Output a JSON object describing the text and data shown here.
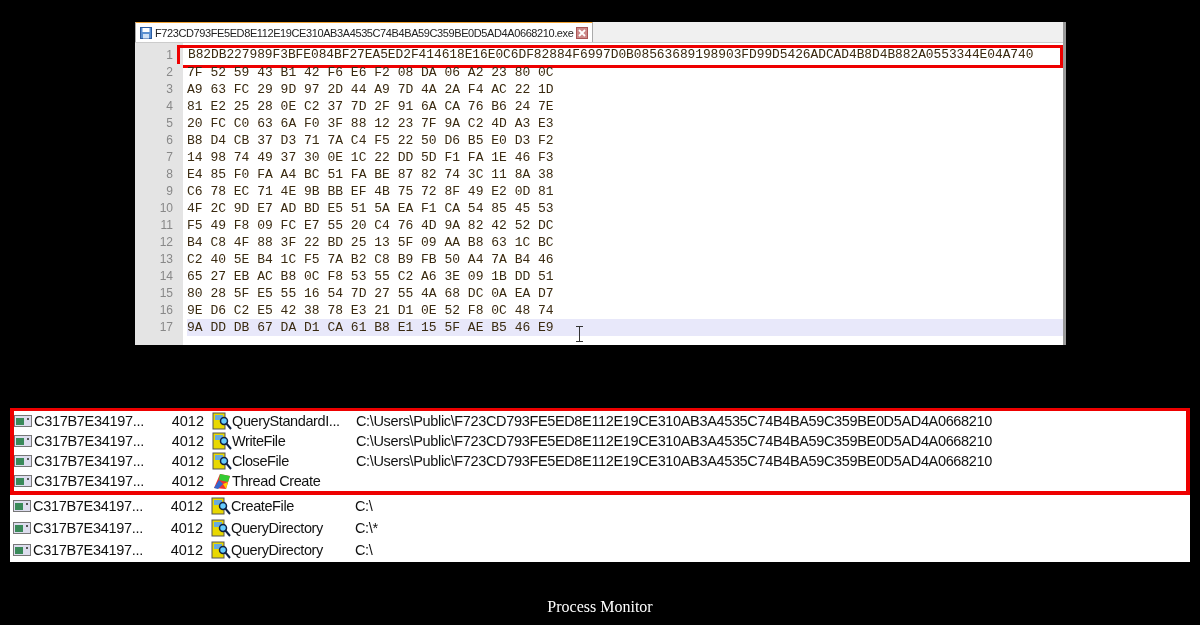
{
  "editor": {
    "tab": {
      "title": "F723CD793FE5ED8E112E19CE310AB3A4535C74B4BA59C359BE0D5AD4A0668210.exe",
      "selected": true
    },
    "lines": [
      {
        "number": "1",
        "text": "B82DB227989F3BFE084BF27EA5ED2F414618E16E0C6DF82884F6997D0B08563689198903FD99D5426ADCAD4B8D4B882A0553344E04A740",
        "current": false,
        "highlighted": true
      },
      {
        "number": "2",
        "text": "7F 52 59 43 B1 42 F6 E6 F2 08 DA 06 A2 23 80 0C",
        "current": false,
        "highlighted": false
      },
      {
        "number": "3",
        "text": "A9 63 FC 29 9D 97 2D 44 A9 7D 4A 2A F4 AC 22 1D",
        "current": false,
        "highlighted": false
      },
      {
        "number": "4",
        "text": "81 E2 25 28 0E C2 37 7D 2F 91 6A CA 76 B6 24 7E",
        "current": false,
        "highlighted": false
      },
      {
        "number": "5",
        "text": "20 FC C0 63 6A F0 3F 88 12 23 7F 9A C2 4D A3 E3",
        "current": false,
        "highlighted": false
      },
      {
        "number": "6",
        "text": "B8 D4 CB 37 D3 71 7A C4 F5 22 50 D6 B5 E0 D3 F2",
        "current": false,
        "highlighted": false
      },
      {
        "number": "7",
        "text": "14 98 74 49 37 30 0E 1C 22 DD 5D F1 FA 1E 46 F3",
        "current": false,
        "highlighted": false
      },
      {
        "number": "8",
        "text": "E4 85 F0 FA A4 BC 51 FA BE 87 82 74 3C 11 8A 38",
        "current": false,
        "highlighted": false
      },
      {
        "number": "9",
        "text": "C6 78 EC 71 4E 9B BB EF 4B 75 72 8F 49 E2 0D 81",
        "current": false,
        "highlighted": false
      },
      {
        "number": "10",
        "text": "4F 2C 9D E7 AD BD E5 51 5A EA F1 CA 54 85 45 53",
        "current": false,
        "highlighted": false
      },
      {
        "number": "11",
        "text": "F5 49 F8 09 FC E7 55 20 C4 76 4D 9A 82 42 52 DC",
        "current": false,
        "highlighted": false
      },
      {
        "number": "12",
        "text": "B4 C8 4F 88 3F 22 BD 25 13 5F 09 AA B8 63 1C BC",
        "current": false,
        "highlighted": false
      },
      {
        "number": "13",
        "text": "C2 40 5E B4 1C F5 7A B2 C8 B9 FB 50 A4 7A B4 46",
        "current": false,
        "highlighted": false
      },
      {
        "number": "14",
        "text": "65 27 EB AC B8 0C F8 53 55 C2 A6 3E 09 1B DD 51",
        "current": false,
        "highlighted": false
      },
      {
        "number": "15",
        "text": "80 28 5F E5 55 16 54 7D 27 55 4A 68 DC 0A EA D7",
        "current": false,
        "highlighted": false
      },
      {
        "number": "16",
        "text": "9E D6 C2 E5 42 38 78 E3 21 D1 0E 52 F8 0C 48 74",
        "current": false,
        "highlighted": false
      },
      {
        "number": "17",
        "text": "9A DD DB 67 DA D1 CA 61 B8 E1 15 5F AE B5 46 E9",
        "current": true,
        "highlighted": false
      }
    ]
  },
  "process_monitor": {
    "rows": [
      {
        "process": "C317B7E34197...",
        "pid": "4012",
        "operation": "QueryStandardI...",
        "kind": "file",
        "path": "C:\\Users\\Public\\F723CD793FE5ED8E112E19CE310AB3A4535C74B4BA59C359BE0D5AD4A0668210",
        "highlighted": true
      },
      {
        "process": "C317B7E34197...",
        "pid": "4012",
        "operation": "WriteFile",
        "kind": "file",
        "path": "C:\\Users\\Public\\F723CD793FE5ED8E112E19CE310AB3A4535C74B4BA59C359BE0D5AD4A0668210",
        "highlighted": true
      },
      {
        "process": "C317B7E34197...",
        "pid": "4012",
        "operation": "CloseFile",
        "kind": "file",
        "path": "C:\\Users\\Public\\F723CD793FE5ED8E112E19CE310AB3A4535C74B4BA59C359BE0D5AD4A0668210",
        "highlighted": true
      },
      {
        "process": "C317B7E34197...",
        "pid": "4012",
        "operation": "Thread Create",
        "kind": "thread",
        "highlighted": true
      },
      {
        "process": "C317B7E34197...",
        "pid": "4012",
        "operation": "CreateFile",
        "kind": "file",
        "path": "C:\\",
        "highlighted": false
      },
      {
        "process": "C317B7E34197...",
        "pid": "4012",
        "operation": "QueryDirectory",
        "kind": "file",
        "path": "C:\\*",
        "highlighted": false
      },
      {
        "process": "C317B7E34197...",
        "pid": "4012",
        "operation": "QueryDirectory",
        "kind": "file",
        "path": "C:\\",
        "highlighted": false
      }
    ]
  },
  "caption": "Process Monitor"
}
